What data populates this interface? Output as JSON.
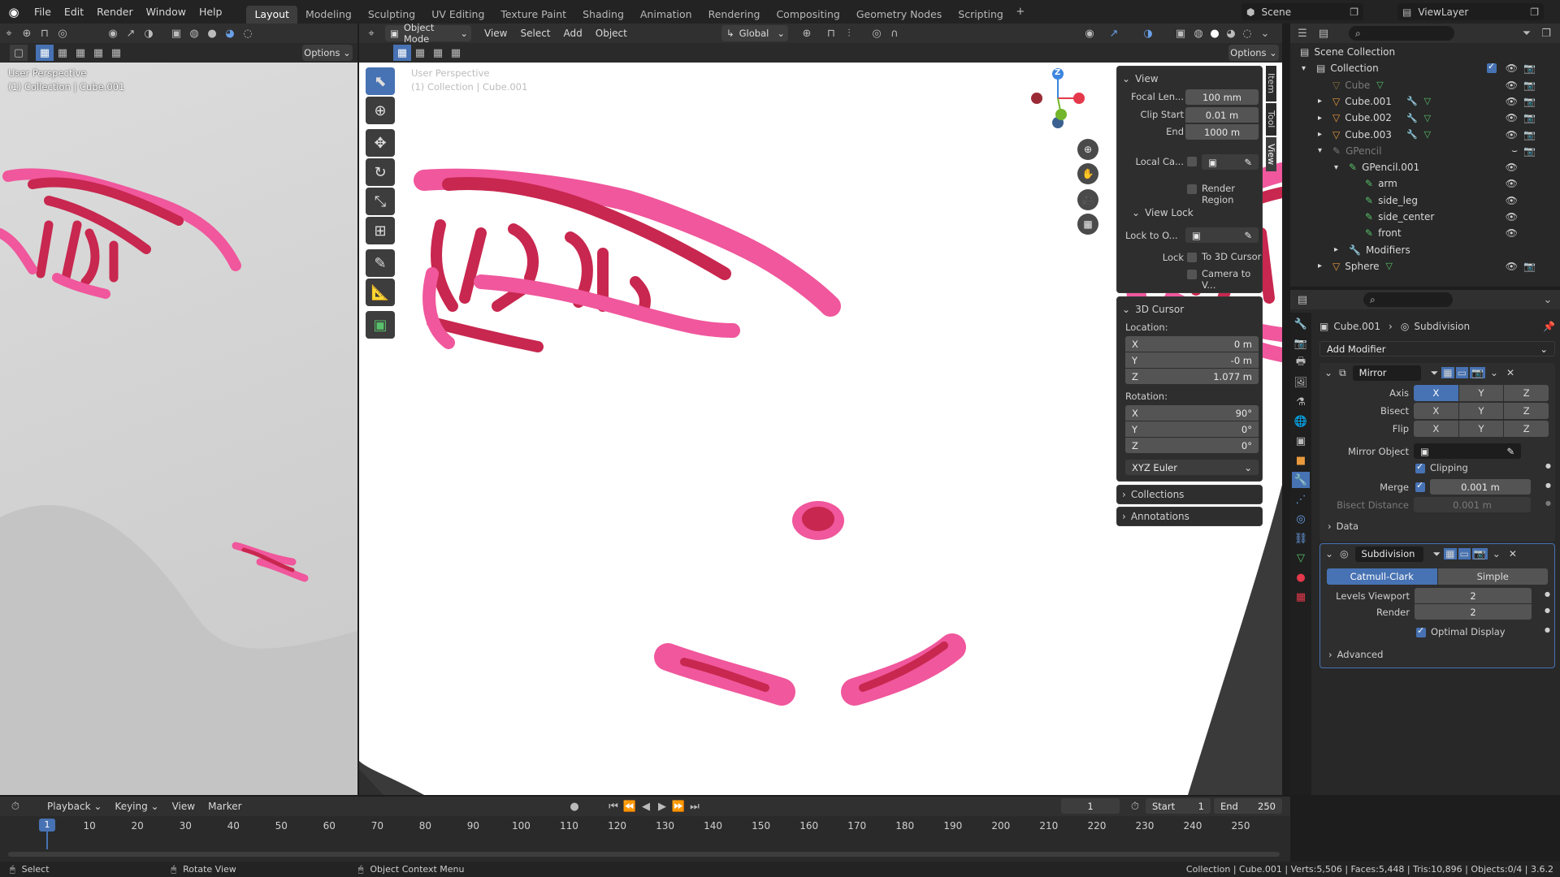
{
  "topbar": {
    "menus": [
      "File",
      "Edit",
      "Render",
      "Window",
      "Help"
    ],
    "workspaces": [
      "Layout",
      "Modeling",
      "Sculpting",
      "UV Editing",
      "Texture Paint",
      "Shading",
      "Animation",
      "Rendering",
      "Compositing",
      "Geometry Nodes",
      "Scripting"
    ],
    "active_workspace": "Layout",
    "scene": "Scene",
    "view_layer": "ViewLayer"
  },
  "left_view": {
    "options": "Options",
    "overlay_title": "User Perspective",
    "overlay_sub": "(1) Collection | Cube.001"
  },
  "main_view": {
    "mode": "Object Mode",
    "menus": [
      "View",
      "Select",
      "Add",
      "Object"
    ],
    "orientation": "Global",
    "options": "Options",
    "overlay_title": "User Perspective",
    "overlay_sub": "(1) Collection | Cube.001",
    "gizmo_z": "Z"
  },
  "n_panel": {
    "tabs": [
      "Item",
      "Tool",
      "View"
    ],
    "view_header": "View",
    "focal_label": "Focal Len...",
    "focal_value": "100 mm",
    "clip_start_label": "Clip Start",
    "clip_start_value": "0.01 m",
    "end_label": "End",
    "end_value": "1000 m",
    "local_cam_label": "Local Ca...",
    "render_region": "Render Region",
    "view_lock_header": "View Lock",
    "lock_to_label": "Lock to O...",
    "lock_label": "Lock",
    "to_3d_cursor": "To 3D Cursor",
    "camera_to_view": "Camera to V...",
    "cursor_header": "3D Cursor",
    "location_label": "Location:",
    "loc_x": "0 m",
    "loc_y": "-0 m",
    "loc_z": "1.077 m",
    "rotation_label": "Rotation:",
    "rot_x": "90°",
    "rot_y": "0°",
    "rot_z": "0°",
    "rot_mode": "XYZ Euler",
    "axis_x": "X",
    "axis_y": "Y",
    "axis_z": "Z",
    "collections": "Collections",
    "annotations": "Annotations"
  },
  "outliner": {
    "items": [
      {
        "name": "Scene Collection",
        "level": 0
      },
      {
        "name": "Collection",
        "level": 1
      },
      {
        "name": "Cube",
        "level": 2
      },
      {
        "name": "Cube.001",
        "level": 2
      },
      {
        "name": "Cube.002",
        "level": 2
      },
      {
        "name": "Cube.003",
        "level": 2
      },
      {
        "name": "GPencil",
        "level": 2
      },
      {
        "name": "GPencil.001",
        "level": 3
      },
      {
        "name": "arm",
        "level": 4
      },
      {
        "name": "side_leg",
        "level": 4
      },
      {
        "name": "side_center",
        "level": 4
      },
      {
        "name": "front",
        "level": 4
      },
      {
        "name": "Modifiers",
        "level": 3
      },
      {
        "name": "Sphere",
        "level": 2
      }
    ]
  },
  "properties": {
    "object": "Cube.001",
    "modifier_crumb": "Subdivision",
    "add_modifier": "Add Modifier",
    "mirror": {
      "name": "Mirror",
      "axis_label": "Axis",
      "bisect_label": "Bisect",
      "flip_label": "Flip",
      "x": "X",
      "y": "Y",
      "z": "Z",
      "mirror_object_label": "Mirror Object",
      "clipping": "Clipping",
      "merge_label": "Merge",
      "merge_value": "0.001 m",
      "bisect_distance_label": "Bisect Distance",
      "bisect_distance_value": "0.001 m",
      "data": "Data"
    },
    "subdivision": {
      "name": "Subdivision",
      "catmull": "Catmull-Clark",
      "simple": "Simple",
      "levels_label": "Levels Viewport",
      "levels_value": "2",
      "render_label": "Render",
      "render_value": "2",
      "optimal": "Optimal Display",
      "advanced": "Advanced"
    }
  },
  "timeline": {
    "menus": [
      "Playback",
      "Keying",
      "View",
      "Marker"
    ],
    "current_frame": "1",
    "start_label": "Start",
    "start": "1",
    "end_label": "End",
    "end": "250",
    "ticks": [
      "1",
      "10",
      "20",
      "30",
      "40",
      "50",
      "60",
      "70",
      "80",
      "90",
      "100",
      "110",
      "120",
      "130",
      "140",
      "150",
      "160",
      "170",
      "180",
      "190",
      "200",
      "210",
      "220",
      "230",
      "240",
      "250"
    ]
  },
  "statusbar": {
    "select": "Select",
    "rotate": "Rotate View",
    "context": "Object Context Menu",
    "stats": "Collection | Cube.001 | Verts:5,506 | Faces:5,448 | Tris:10,896 | Objects:0/4 | 3.6.2"
  },
  "colors": {
    "accent": "#4772b3",
    "paint_dark": "#c8274f",
    "paint_light": "#f0579c",
    "orange": "#e89a3c",
    "green": "#58c06a"
  }
}
